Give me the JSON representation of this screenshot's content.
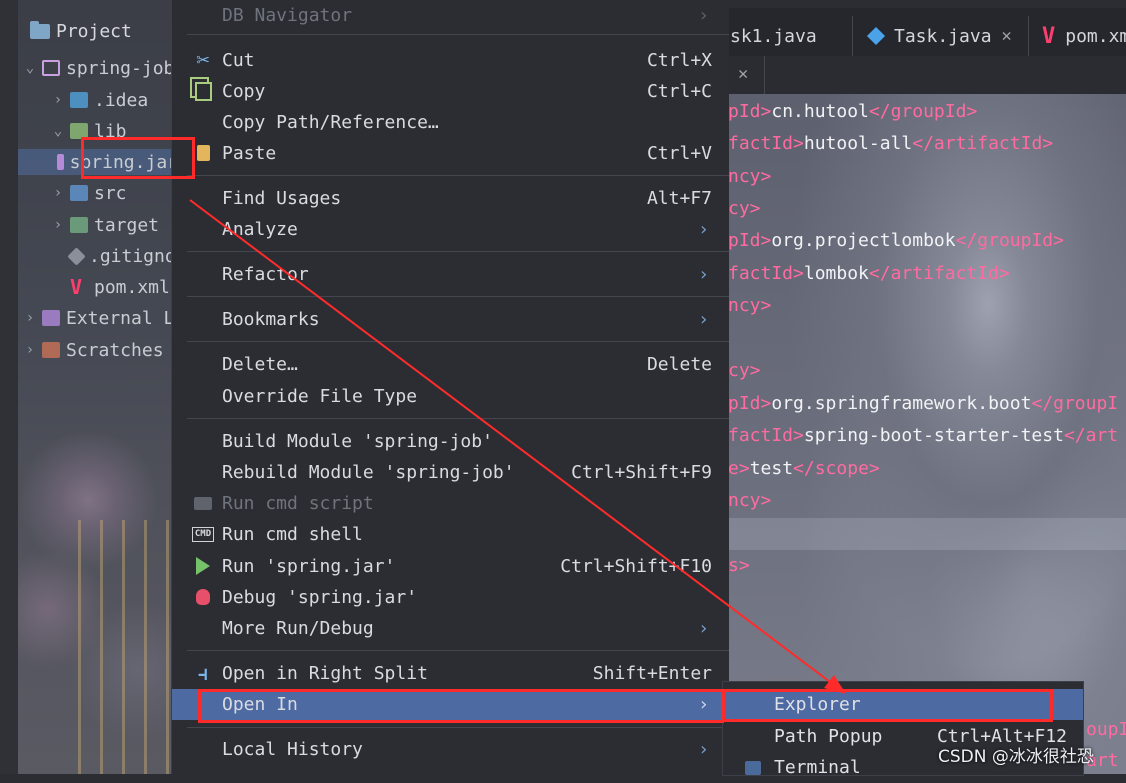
{
  "project": {
    "title": "Project",
    "tree": [
      "spring-job",
      ".idea",
      "lib",
      "spring.jar",
      "src",
      "target",
      ".gitignore",
      "pom.xml",
      "External Libraries",
      "Scratches and Consoles"
    ]
  },
  "tabs": [
    "sk1.java",
    "Task.java",
    "pom.xml"
  ],
  "code": {
    "l1": {
      "a": "pId>",
      "b": "cn.hutool",
      "c": "</groupId>"
    },
    "l2": {
      "a": "factId>",
      "b": "hutool-all",
      "c": "</artifactId>"
    },
    "l3": "ncy>",
    "l4": "cy>",
    "l5": {
      "a": "pId>",
      "b": "org.projectlombok",
      "c": "</groupId>"
    },
    "l6": {
      "a": "factId>",
      "b": "lombok",
      "c": "</artifactId>"
    },
    "l7": "ncy>",
    "l8": "cy>",
    "l9": {
      "a": "pId>",
      "b": "org.springframework.boot",
      "c": "</groupI"
    },
    "l10": {
      "a": "factId>",
      "b": "spring-boot-starter-test",
      "c": "</art"
    },
    "l11": {
      "a": "e>",
      "b": "test",
      "c": "</scope>"
    },
    "l12": "ncy>",
    "l13": "s>",
    "l14": "oupI",
    "l15": "art"
  },
  "menu": {
    "db_navigator": "DB Navigator",
    "cut": "Cut",
    "cut_sc": "Ctrl+X",
    "copy": "Copy",
    "copy_sc": "Ctrl+C",
    "copy_path": "Copy Path/Reference…",
    "paste": "Paste",
    "paste_sc": "Ctrl+V",
    "find_usages": "Find Usages",
    "find_usages_sc": "Alt+F7",
    "analyze": "Analyze",
    "refactor": "Refactor",
    "bookmarks": "Bookmarks",
    "delete": "Delete…",
    "delete_sc": "Delete",
    "override_file_type": "Override File Type",
    "build_module": "Build Module 'spring-job'",
    "rebuild_module": "Rebuild Module 'spring-job'",
    "rebuild_sc": "Ctrl+Shift+F9",
    "run_cmd_script": "Run cmd script",
    "run_cmd_shell": "Run cmd shell",
    "run": "Run 'spring.jar'",
    "run_sc": "Ctrl+Shift+F10",
    "debug": "Debug 'spring.jar'",
    "more_run_debug": "More Run/Debug",
    "open_right_split": "Open in Right Split",
    "open_right_split_sc": "Shift+Enter",
    "open_in": "Open In",
    "local_history": "Local History"
  },
  "submenu": {
    "explorer": "Explorer",
    "path_popup": "Path Popup",
    "path_popup_sc": "Ctrl+Alt+F12",
    "terminal": "Terminal"
  },
  "watermark": "CSDN @冰冰很社恐",
  "colors": {
    "accent": "#4e6aa3",
    "highlight": "#ff2b2b",
    "tag": "#ff6ba0"
  }
}
